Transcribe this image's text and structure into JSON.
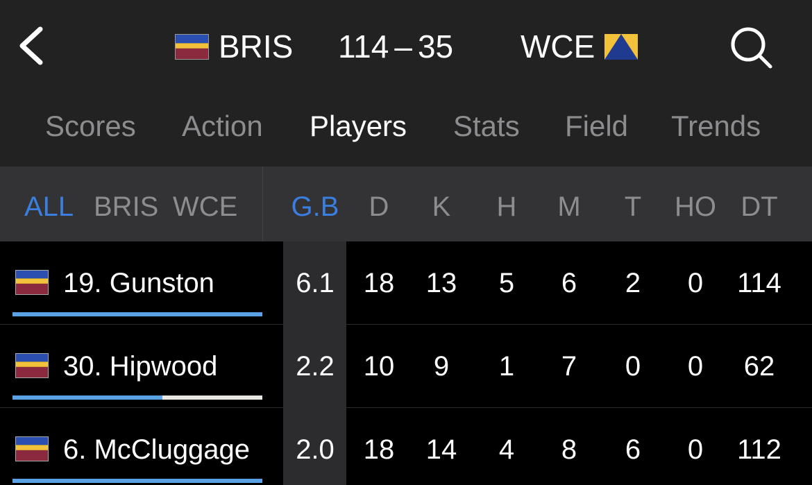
{
  "header": {
    "home_team": "BRIS",
    "away_team": "WCE",
    "home_score": "114",
    "away_score": "35",
    "score_separator": "–",
    "icons": {
      "back": "chevron-left-icon",
      "search": "search-icon"
    }
  },
  "tabs": [
    {
      "label": "Scores",
      "active": false
    },
    {
      "label": "Action",
      "active": false
    },
    {
      "label": "Players",
      "active": true
    },
    {
      "label": "Stats",
      "active": false
    },
    {
      "label": "Field",
      "active": false
    },
    {
      "label": "Trends",
      "active": false
    }
  ],
  "filters": [
    {
      "label": "ALL",
      "active": true
    },
    {
      "label": "BRIS",
      "active": false
    },
    {
      "label": "WCE",
      "active": false
    }
  ],
  "columns": [
    {
      "label": "G.B",
      "active": true
    },
    {
      "label": "D",
      "active": false
    },
    {
      "label": "K",
      "active": false
    },
    {
      "label": "H",
      "active": false
    },
    {
      "label": "M",
      "active": false
    },
    {
      "label": "T",
      "active": false
    },
    {
      "label": "HO",
      "active": false
    },
    {
      "label": "DT",
      "active": false
    }
  ],
  "players": [
    {
      "name": "19. Gunston",
      "team": "BRIS",
      "progress": 1.0,
      "stats": [
        "6.1",
        "18",
        "13",
        "5",
        "6",
        "2",
        "0",
        "114"
      ]
    },
    {
      "name": "30. Hipwood",
      "team": "BRIS",
      "progress": 0.6,
      "stats": [
        "2.2",
        "10",
        "9",
        "1",
        "7",
        "0",
        "0",
        "62"
      ]
    },
    {
      "name": "6. McCluggage",
      "team": "BRIS",
      "progress": 1.0,
      "stats": [
        "2.0",
        "18",
        "14",
        "4",
        "8",
        "6",
        "0",
        "112"
      ]
    }
  ],
  "colors": {
    "accent": "#3a7ee0",
    "bar": "#5aa2e4",
    "bris_flag": [
      "#2a4fb0",
      "#f2c23a",
      "#8b2a3e"
    ],
    "wce_flag": [
      "#f2c23a",
      "#1f3a8f"
    ]
  }
}
